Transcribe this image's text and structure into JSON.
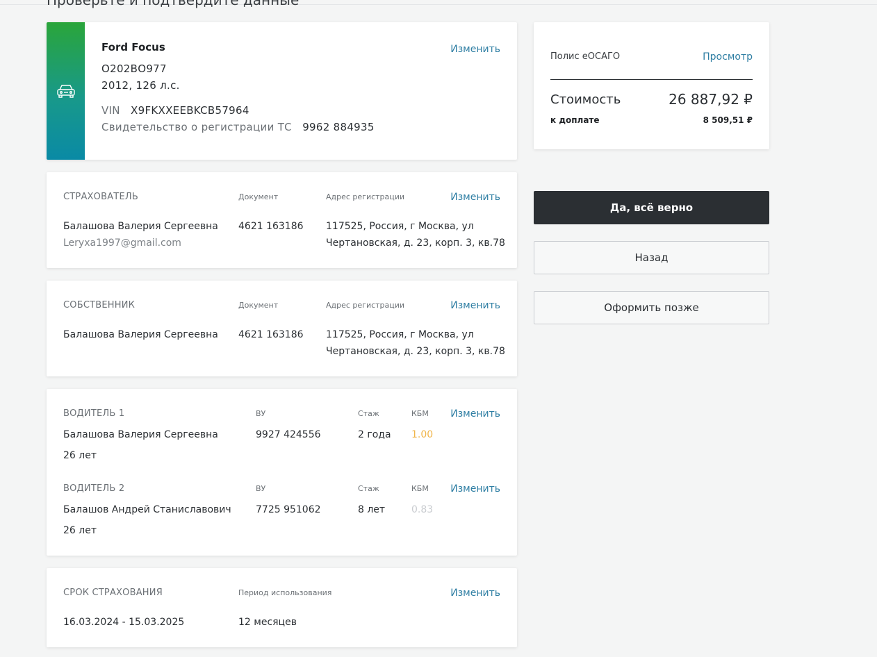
{
  "page": {
    "title": "Проверьте и подтвердите данные"
  },
  "car": {
    "model": "Ford Focus",
    "plate": "О202ВО977",
    "year_power": "2012, 126 л.с.",
    "vin_label": "VIN",
    "vin": "X9FKXXEEBKCB57964",
    "cert_label": "Свидетельство о регистрации ТС",
    "cert": "9962 884935",
    "edit_label": "Изменить",
    "icon": "car-icon"
  },
  "insurer": {
    "caption": "СТРАХОВАТЕЛЬ",
    "doc_label": "Документ",
    "addr_label": "Адрес регистрации",
    "edit_label": "Изменить",
    "name": "Балашова Валерия Сергеевна",
    "email": "Leryxa1997@gmail.com",
    "doc": "4621 163186",
    "addr_line1": "117525, Россия, г Москва, ул",
    "addr_line2": "Чертановская, д. 23, корп. 3, кв.78"
  },
  "owner": {
    "caption": "СОБСТВЕННИК",
    "doc_label": "Документ",
    "addr_label": "Адрес регистрации",
    "edit_label": "Изменить",
    "name": "Балашова Валерия Сергеевна",
    "doc": "4621 163186",
    "addr_line1": "117525, Россия, г Москва, ул",
    "addr_line2": "Чертановская, д. 23, корп. 3, кв.78"
  },
  "drivers": [
    {
      "caption": "ВОДИТЕЛЬ 1",
      "license_label": "ВУ",
      "exp_label": "Стаж",
      "kbm_label": "КБМ",
      "edit_label": "Изменить",
      "name": "Балашова Валерия Сергеевна",
      "age": "26 лет",
      "license": "9927 424556",
      "experience": "2 года",
      "kbm": "1.00",
      "kbm_color": "#f0b54a"
    },
    {
      "caption": "ВОДИТЕЛЬ 2",
      "license_label": "ВУ",
      "exp_label": "Стаж",
      "kbm_label": "КБМ",
      "edit_label": "Изменить",
      "name": "Балашов Андрей Станиславович",
      "age": "26 лет",
      "license": "7725 951062",
      "experience": "8 лет",
      "kbm": "0.83",
      "kbm_color": "#c9ccd0"
    }
  ],
  "term": {
    "caption": "СРОК СТРАХОВАНИЯ",
    "period_label": "Период использования",
    "edit_label": "Изменить",
    "dates": "16.03.2024 - 15.03.2025",
    "period": "12 месяцев"
  },
  "policy": {
    "label": "Полис еОСАГО",
    "view_link": "Просмотр",
    "cost_label": "Стоимость",
    "cost": "26 887,92 ₽",
    "pay_label": "к доплате",
    "pay": "8 509,51 ₽"
  },
  "actions": {
    "confirm": "Да, всё верно",
    "back": "Назад",
    "later": "Оформить позже"
  }
}
